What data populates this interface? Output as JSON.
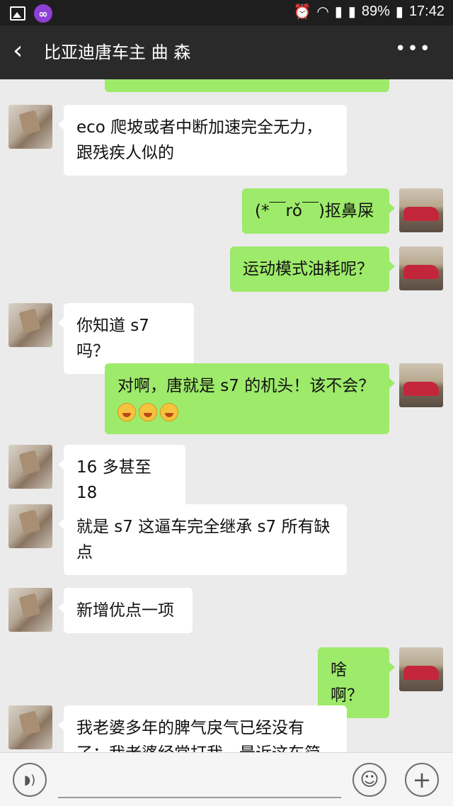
{
  "status": {
    "battery": "89%",
    "time": "17:42",
    "icons": [
      "gallery-icon",
      "app-icon",
      "alarm-icon",
      "wifi-icon",
      "signal-icon",
      "signal-icon",
      "battery-icon"
    ]
  },
  "header": {
    "title": "比亚迪唐车主 曲 森",
    "back_icon": "chevron-left-icon",
    "more_icon": "more-icon"
  },
  "messages": [
    {
      "sender": "other",
      "lines": [
        "eco 爬坡或者中断加速完全无力，",
        "跟残疾人似的"
      ]
    },
    {
      "sender": "me",
      "lines": [
        "(*￣rǒ￣)抠鼻屎"
      ]
    },
    {
      "sender": "me",
      "lines": [
        "运动模式油耗呢？"
      ]
    },
    {
      "sender": "other",
      "lines": [
        "你知道 s7 吗？"
      ]
    },
    {
      "sender": "me",
      "lines": [
        "对啊，唐就是 s7 的机头！该不会？"
      ],
      "emojis": [
        "crying-laughing-emoji",
        "crying-laughing-emoji",
        "crying-laughing-emoji"
      ]
    },
    {
      "sender": "other",
      "lines": [
        "16 多甚至 18"
      ]
    },
    {
      "sender": "other",
      "lines": [
        "就是 s7 这逼车完全继承 s7 所有缺",
        "点"
      ]
    },
    {
      "sender": "other",
      "lines": [
        "新增优点一项"
      ]
    },
    {
      "sender": "me",
      "lines": [
        "啥啊？"
      ]
    },
    {
      "sender": "other",
      "lines": [
        "我老婆多年的脾气戾气已经没有",
        "了：我老婆经常打我，最近这车简"
      ]
    }
  ],
  "input_bar": {
    "voice_icon": "voice-icon",
    "emoji_icon": "emoji-icon",
    "plus_icon": "plus-icon"
  },
  "colors": {
    "my_bubble": "#9eea6a",
    "their_bubble": "#ffffff",
    "chat_bg": "#ebebeb",
    "nav_bg": "#2a2a2a"
  }
}
